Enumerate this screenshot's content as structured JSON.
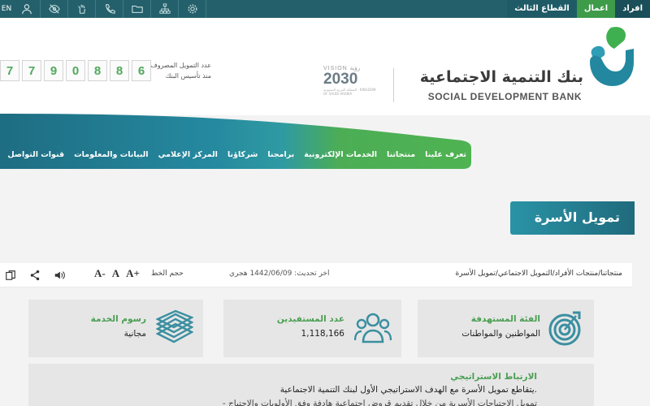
{
  "topbar": {
    "lang_label": "EN",
    "tabs": [
      {
        "label": "افراد"
      },
      {
        "label": "اعمال"
      },
      {
        "label": "القطاع الثالث"
      }
    ],
    "icons": [
      "sitemap-icon",
      "folder-icon",
      "phone-icon",
      "sign-language-icon",
      "eye-slash-icon",
      "user-icon",
      "gear-icon"
    ]
  },
  "header": {
    "bank_name_ar": "بنك التنمية الاجتماعية",
    "bank_name_en": "SOCIAL DEVELOPMENT BANK",
    "vision_label": "VISION رؤية",
    "vision_year": "2030",
    "vision_sub": "المملكة العربية السعودية · KINGDOM OF SAUDI ARABIA",
    "counter_label_1": "عدد التمويل المصروف",
    "counter_label_2": "منذ تأسيس البنك",
    "counter_digits": [
      "6",
      "8",
      "8",
      "0",
      "9",
      "7",
      "7"
    ]
  },
  "nav": {
    "items": [
      "تعرف علينا",
      "منتجاتنا",
      "الخدمات الإلكترونية",
      "برامجنا",
      "شركاؤنا",
      "المركز الإعلامي",
      "البيانات والمعلومات",
      "قنوات التواصل"
    ]
  },
  "page": {
    "title": "تمويل الأسرة"
  },
  "utility": {
    "breadcrumb": "منتجاتنا/منتجات الأفراد/التمويل الاجتماعي/تمويل الأسرة",
    "updated": "اخر تحديث: 1442/06/09 هجري",
    "font_size_label": "حجم الخط",
    "font_plus": "A+",
    "font_normal": "A",
    "font_minus": "A-"
  },
  "cards": {
    "target": {
      "label": "الفئة المستهدفة",
      "value": "المواطنين والمواطنات",
      "icon": "target-icon"
    },
    "beneficiaries": {
      "label": "عدد المستفيدين",
      "value": "1,118,166",
      "icon": "users-group-icon"
    },
    "fees": {
      "label": "رسوم الخدمة",
      "value": "مجانية",
      "icon": "money-stack-icon"
    }
  },
  "strategy": {
    "heading": "الارتباط الاستراتيجي",
    "text": "يتقاطع تمويل الأسرة مع الهدف الاستراتيجي الأول لبنك التنمية الاجتماعية.",
    "text2": "- تمويل الاحتياجات الأسرية من خلال تقديم قروض اجتماعية هادفة وفق الأولويات والاحتياج"
  },
  "colors": {
    "primary": "#24606b",
    "green": "#3d9b49",
    "accent_teal": "#2a93a6"
  }
}
